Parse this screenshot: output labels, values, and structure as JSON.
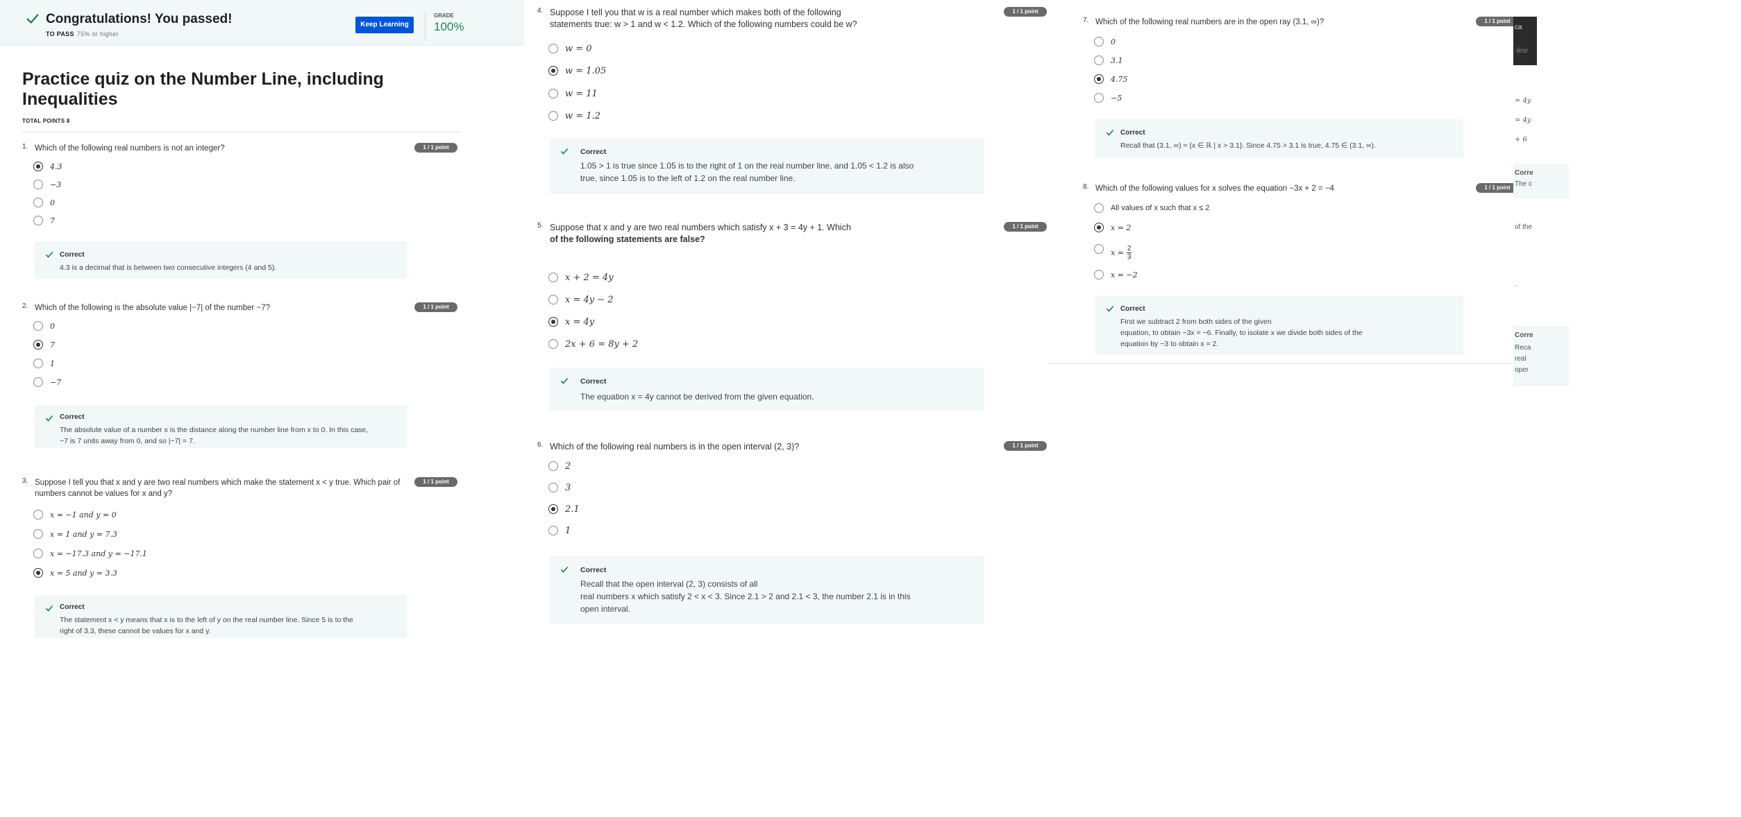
{
  "header": {
    "congrats": "Congratulations! You passed!",
    "to_pass_label": "TO PASS",
    "to_pass_value": "75% or higher",
    "keep_learning": "Keep Learning",
    "grade_label": "GRADE",
    "grade_value": "100%"
  },
  "quiz": {
    "title": "Practice quiz on the Number Line, including Inequalities",
    "total_points": "TOTAL POINTS 8"
  },
  "points_label": "1 / 1 point",
  "correct_label": "Correct",
  "questions": [
    {
      "num": "1.",
      "text": "Which of the following real numbers is not an integer?",
      "options": [
        "4.3",
        "−3",
        "0",
        "7"
      ],
      "selected": 0,
      "feedback": "4.3 is a decimal that is between two consecutive integers (4 and 5)."
    },
    {
      "num": "2.",
      "text": "Which of the following is the absolute value |−7| of the number −7?",
      "options": [
        "0",
        "7",
        "1",
        "−7"
      ],
      "selected": 1,
      "feedback_line1": "The absolute value of a number x is the distance along the number line from x to 0. In this case,",
      "feedback_line2": "−7 is 7 units away from 0, and so |−7| = 7."
    },
    {
      "num": "3.",
      "text_line1": "Suppose I tell you that x and y are two real numbers which make the statement x < y true. Which pair of",
      "text_line2": "numbers cannot be values for x and y?",
      "options": [
        "x = −1 and y = 0",
        "x = 1 and y = 7.3",
        "x = −17.3 and y = −17.1",
        "x = 5 and y = 3.3"
      ],
      "selected": 3,
      "feedback_line1": "The statement x < y means that x is to the left of y on the real number line. Since 5 is to the",
      "feedback_line2": "right of 3.3, these cannot be values for x and y."
    },
    {
      "num": "4.",
      "text_line1": "Suppose I tell you that w is a real number which makes both of the following",
      "text_line2": "statements true: w > 1 and w < 1.2. Which of the following numbers could be w?",
      "options": [
        "w = 0",
        "w = 1.05",
        "w = 11",
        "w = 1.2"
      ],
      "selected": 1,
      "feedback_line1": "1.05 > 1 is true since 1.05 is to the right of 1 on the real number line, and 1.05 < 1.2 is also",
      "feedback_line2": "true, since 1.05 is to the left of 1.2 on the real number line."
    },
    {
      "num": "5.",
      "text_line1": "Suppose that x and y are two real numbers which satisfy x + 3 = 4y + 1. Which",
      "text_line2": "of the following statements are false?",
      "options": [
        "x + 2 = 4y",
        "x = 4y − 2",
        "x = 4y",
        "2x + 6 = 8y + 2"
      ],
      "selected": 2,
      "feedback": "The equation x = 4y cannot be derived from the given equation."
    },
    {
      "num": "6.",
      "text": "Which of the following real numbers is in the open interval (2, 3)?",
      "options": [
        "2",
        "3",
        "2.1",
        "1"
      ],
      "selected": 2,
      "feedback_line1": "Recall that the open interval (2, 3) consists of all",
      "feedback_line2": "real numbers x which satisfy 2 < x < 3. Since 2.1 > 2 and 2.1 < 3, the number 2.1 is in this",
      "feedback_line3": "open interval."
    },
    {
      "num": "7.",
      "text": "Which of the following real numbers are in the open ray (3.1, ∞)?",
      "options": [
        "0",
        "3.1",
        "4.75",
        "−5"
      ],
      "selected": 2,
      "feedback": "Recall that (3.1, ∞) = {x ∈ ℝ | x > 3.1}. Since 4.75 > 3.1 is true, 4.75 ∈ (3.1, ∞)."
    },
    {
      "num": "8.",
      "text": "Which of the following values for x solves the equation −3x + 2 = −4",
      "options": [
        "All values of x such that x ≤ 2",
        "x = 2",
        "x =",
        "x = −2"
      ],
      "frac_num": "2",
      "frac_den": "3",
      "selected": 1,
      "feedback_line1": "First we subtract 2 from both sides of the given",
      "feedback_line2": "equation, to obtain −3x = −6. Finally, to isolate x we divide both sides of the",
      "feedback_line3": "equation by −3 to obtain x = 2."
    }
  ],
  "sliver": {
    "tile_text1": "ca",
    "tile_text2": "-line",
    "texts": [
      "= 4y",
      "= 4y",
      "+ 6",
      "Corre",
      "The c",
      "of the",
      ".",
      "Corre",
      "Reca",
      "real",
      "oper"
    ]
  }
}
